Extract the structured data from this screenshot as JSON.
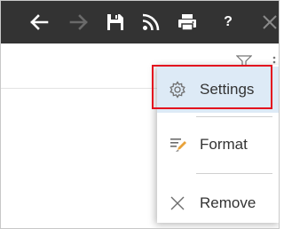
{
  "toolbar": {
    "background": "#333333",
    "icons": [
      "back-arrow-icon",
      "forward-arrow-icon",
      "save-icon",
      "rss-icon",
      "print-icon",
      "help-icon",
      "close-icon"
    ],
    "help_label": "?"
  },
  "context_menu": {
    "items": [
      {
        "label": "Settings",
        "icon": "gear-icon",
        "highlighted": true
      },
      {
        "label": "Format",
        "icon": "format-brush-icon",
        "highlighted": false
      },
      {
        "label": "Remove",
        "icon": "x-icon",
        "highlighted": false
      }
    ],
    "hover_color": "#ddeaf6",
    "annotation_color": "#e3101e"
  }
}
